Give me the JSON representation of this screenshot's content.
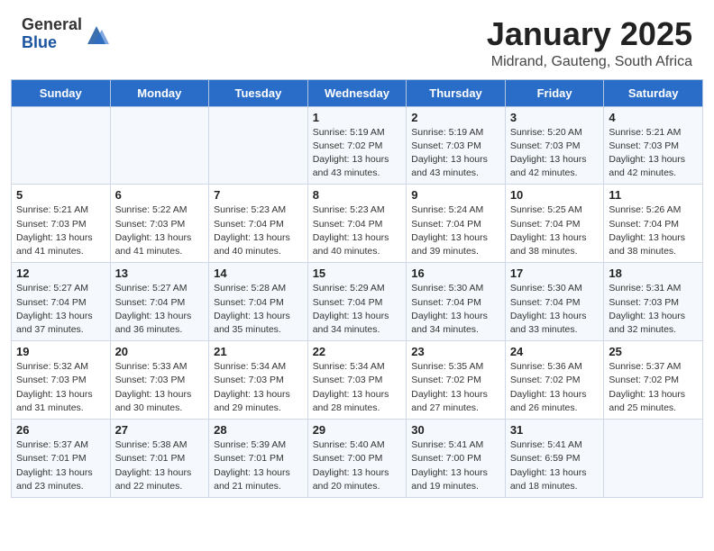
{
  "header": {
    "logo_general": "General",
    "logo_blue": "Blue",
    "month_title": "January 2025",
    "location": "Midrand, Gauteng, South Africa"
  },
  "days_of_week": [
    "Sunday",
    "Monday",
    "Tuesday",
    "Wednesday",
    "Thursday",
    "Friday",
    "Saturday"
  ],
  "weeks": [
    [
      {
        "day": "",
        "info": ""
      },
      {
        "day": "",
        "info": ""
      },
      {
        "day": "",
        "info": ""
      },
      {
        "day": "1",
        "info": "Sunrise: 5:19 AM\nSunset: 7:02 PM\nDaylight: 13 hours\nand 43 minutes."
      },
      {
        "day": "2",
        "info": "Sunrise: 5:19 AM\nSunset: 7:03 PM\nDaylight: 13 hours\nand 43 minutes."
      },
      {
        "day": "3",
        "info": "Sunrise: 5:20 AM\nSunset: 7:03 PM\nDaylight: 13 hours\nand 42 minutes."
      },
      {
        "day": "4",
        "info": "Sunrise: 5:21 AM\nSunset: 7:03 PM\nDaylight: 13 hours\nand 42 minutes."
      }
    ],
    [
      {
        "day": "5",
        "info": "Sunrise: 5:21 AM\nSunset: 7:03 PM\nDaylight: 13 hours\nand 41 minutes."
      },
      {
        "day": "6",
        "info": "Sunrise: 5:22 AM\nSunset: 7:03 PM\nDaylight: 13 hours\nand 41 minutes."
      },
      {
        "day": "7",
        "info": "Sunrise: 5:23 AM\nSunset: 7:04 PM\nDaylight: 13 hours\nand 40 minutes."
      },
      {
        "day": "8",
        "info": "Sunrise: 5:23 AM\nSunset: 7:04 PM\nDaylight: 13 hours\nand 40 minutes."
      },
      {
        "day": "9",
        "info": "Sunrise: 5:24 AM\nSunset: 7:04 PM\nDaylight: 13 hours\nand 39 minutes."
      },
      {
        "day": "10",
        "info": "Sunrise: 5:25 AM\nSunset: 7:04 PM\nDaylight: 13 hours\nand 38 minutes."
      },
      {
        "day": "11",
        "info": "Sunrise: 5:26 AM\nSunset: 7:04 PM\nDaylight: 13 hours\nand 38 minutes."
      }
    ],
    [
      {
        "day": "12",
        "info": "Sunrise: 5:27 AM\nSunset: 7:04 PM\nDaylight: 13 hours\nand 37 minutes."
      },
      {
        "day": "13",
        "info": "Sunrise: 5:27 AM\nSunset: 7:04 PM\nDaylight: 13 hours\nand 36 minutes."
      },
      {
        "day": "14",
        "info": "Sunrise: 5:28 AM\nSunset: 7:04 PM\nDaylight: 13 hours\nand 35 minutes."
      },
      {
        "day": "15",
        "info": "Sunrise: 5:29 AM\nSunset: 7:04 PM\nDaylight: 13 hours\nand 34 minutes."
      },
      {
        "day": "16",
        "info": "Sunrise: 5:30 AM\nSunset: 7:04 PM\nDaylight: 13 hours\nand 34 minutes."
      },
      {
        "day": "17",
        "info": "Sunrise: 5:30 AM\nSunset: 7:04 PM\nDaylight: 13 hours\nand 33 minutes."
      },
      {
        "day": "18",
        "info": "Sunrise: 5:31 AM\nSunset: 7:03 PM\nDaylight: 13 hours\nand 32 minutes."
      }
    ],
    [
      {
        "day": "19",
        "info": "Sunrise: 5:32 AM\nSunset: 7:03 PM\nDaylight: 13 hours\nand 31 minutes."
      },
      {
        "day": "20",
        "info": "Sunrise: 5:33 AM\nSunset: 7:03 PM\nDaylight: 13 hours\nand 30 minutes."
      },
      {
        "day": "21",
        "info": "Sunrise: 5:34 AM\nSunset: 7:03 PM\nDaylight: 13 hours\nand 29 minutes."
      },
      {
        "day": "22",
        "info": "Sunrise: 5:34 AM\nSunset: 7:03 PM\nDaylight: 13 hours\nand 28 minutes."
      },
      {
        "day": "23",
        "info": "Sunrise: 5:35 AM\nSunset: 7:02 PM\nDaylight: 13 hours\nand 27 minutes."
      },
      {
        "day": "24",
        "info": "Sunrise: 5:36 AM\nSunset: 7:02 PM\nDaylight: 13 hours\nand 26 minutes."
      },
      {
        "day": "25",
        "info": "Sunrise: 5:37 AM\nSunset: 7:02 PM\nDaylight: 13 hours\nand 25 minutes."
      }
    ],
    [
      {
        "day": "26",
        "info": "Sunrise: 5:37 AM\nSunset: 7:01 PM\nDaylight: 13 hours\nand 23 minutes."
      },
      {
        "day": "27",
        "info": "Sunrise: 5:38 AM\nSunset: 7:01 PM\nDaylight: 13 hours\nand 22 minutes."
      },
      {
        "day": "28",
        "info": "Sunrise: 5:39 AM\nSunset: 7:01 PM\nDaylight: 13 hours\nand 21 minutes."
      },
      {
        "day": "29",
        "info": "Sunrise: 5:40 AM\nSunset: 7:00 PM\nDaylight: 13 hours\nand 20 minutes."
      },
      {
        "day": "30",
        "info": "Sunrise: 5:41 AM\nSunset: 7:00 PM\nDaylight: 13 hours\nand 19 minutes."
      },
      {
        "day": "31",
        "info": "Sunrise: 5:41 AM\nSunset: 6:59 PM\nDaylight: 13 hours\nand 18 minutes."
      },
      {
        "day": "",
        "info": ""
      }
    ]
  ]
}
